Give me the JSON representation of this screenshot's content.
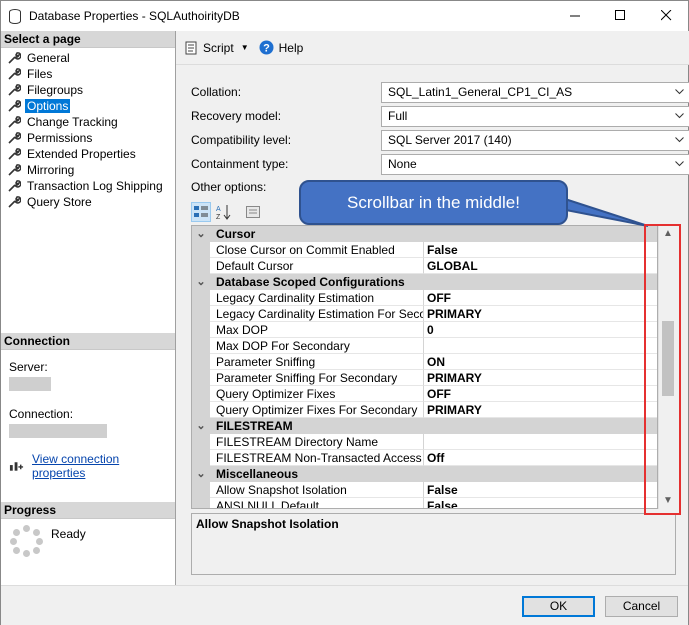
{
  "window": {
    "title": "Database Properties - SQLAuthoirityDB"
  },
  "left_pane": {
    "select_page_header": "Select a page",
    "pages": [
      {
        "label": "General",
        "selected": false
      },
      {
        "label": "Files",
        "selected": false
      },
      {
        "label": "Filegroups",
        "selected": false
      },
      {
        "label": "Options",
        "selected": true
      },
      {
        "label": "Change Tracking",
        "selected": false
      },
      {
        "label": "Permissions",
        "selected": false
      },
      {
        "label": "Extended Properties",
        "selected": false
      },
      {
        "label": "Mirroring",
        "selected": false
      },
      {
        "label": "Transaction Log Shipping",
        "selected": false
      },
      {
        "label": "Query Store",
        "selected": false
      }
    ],
    "connection_header": "Connection",
    "server_label": "Server:",
    "connection_label": "Connection:",
    "view_connection_link": "View connection properties",
    "progress_header": "Progress",
    "progress_status": "Ready"
  },
  "toolbar": {
    "script_label": "Script",
    "help_label": "Help"
  },
  "form": {
    "collation_label": "Collation:",
    "collation_value": "SQL_Latin1_General_CP1_CI_AS",
    "recovery_label": "Recovery model:",
    "recovery_value": "Full",
    "compat_label": "Compatibility level:",
    "compat_value": "SQL Server 2017 (140)",
    "containment_label": "Containment type:",
    "containment_value": "None",
    "other_options_label": "Other options:"
  },
  "property_grid": {
    "rows": [
      {
        "type": "category",
        "name": "Cursor"
      },
      {
        "type": "prop",
        "name": "Close Cursor on Commit Enabled",
        "value": "False"
      },
      {
        "type": "prop",
        "name": "Default Cursor",
        "value": "GLOBAL"
      },
      {
        "type": "category",
        "name": "Database Scoped Configurations"
      },
      {
        "type": "prop",
        "name": "Legacy Cardinality Estimation",
        "value": "OFF"
      },
      {
        "type": "prop",
        "name": "Legacy Cardinality Estimation For Secondary",
        "value": "PRIMARY"
      },
      {
        "type": "prop",
        "name": "Max DOP",
        "value": "0"
      },
      {
        "type": "prop",
        "name": "Max DOP For Secondary",
        "value": ""
      },
      {
        "type": "prop",
        "name": "Parameter Sniffing",
        "value": "ON"
      },
      {
        "type": "prop",
        "name": "Parameter Sniffing For Secondary",
        "value": "PRIMARY"
      },
      {
        "type": "prop",
        "name": "Query Optimizer Fixes",
        "value": "OFF"
      },
      {
        "type": "prop",
        "name": "Query Optimizer Fixes For Secondary",
        "value": "PRIMARY"
      },
      {
        "type": "category",
        "name": "FILESTREAM"
      },
      {
        "type": "prop",
        "name": "FILESTREAM Directory Name",
        "value": ""
      },
      {
        "type": "prop",
        "name": "FILESTREAM Non-Transacted Access",
        "value": "Off"
      },
      {
        "type": "category",
        "name": "Miscellaneous"
      },
      {
        "type": "prop",
        "name": "Allow Snapshot Isolation",
        "value": "False"
      },
      {
        "type": "prop",
        "name": "ANSI NULL Default",
        "value": "False"
      }
    ],
    "scroll_position_fraction": 0.45
  },
  "description": {
    "title": "Allow Snapshot Isolation"
  },
  "footer": {
    "ok_label": "OK",
    "cancel_label": "Cancel"
  },
  "annotation": {
    "callout_text": "Scrollbar in the middle!",
    "callout_color": "#4472c4",
    "highlight_color": "#e53030"
  }
}
